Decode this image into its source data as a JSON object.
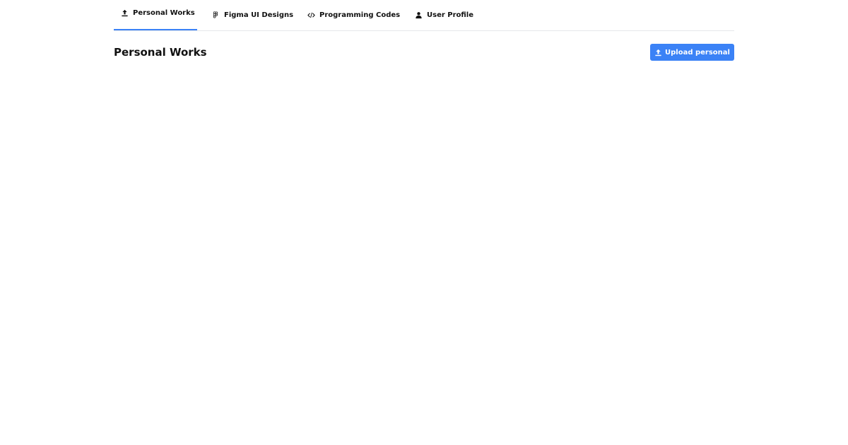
{
  "tabs": [
    {
      "label": "Personal Works",
      "icon": "upload-icon",
      "active": true
    },
    {
      "label": "Figma UI Designs",
      "icon": "figma-icon",
      "active": false
    },
    {
      "label": "Programming Codes",
      "icon": "code-icon",
      "active": false
    },
    {
      "label": "User Profile",
      "icon": "user-icon",
      "active": false
    }
  ],
  "main": {
    "title": "Personal Works",
    "upload_button_label": "Upload personal"
  },
  "colors": {
    "accent": "#3b82f6",
    "divider": "#e5e7eb",
    "text": "#111111"
  }
}
